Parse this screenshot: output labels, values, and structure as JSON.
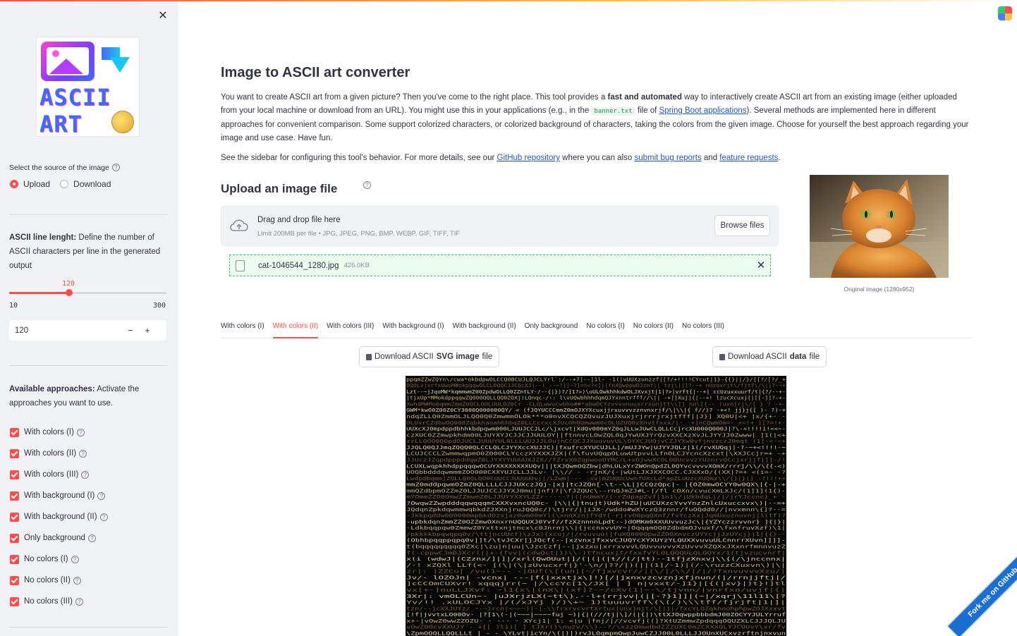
{
  "sidebar": {
    "close_icon": "close-icon",
    "logo_line1": "ASCII",
    "logo_line2": "ART",
    "source_label": "Select the source of the image",
    "source_options": [
      "Upload",
      "Download"
    ],
    "source_selected": "Upload",
    "line_length_title": "ASCII line lenght:",
    "line_length_desc": "Define the number of ASCII characters per line in the generated output",
    "slider_value": "120",
    "slider_min": "10",
    "slider_max": "300",
    "number_input_value": "120",
    "minus_label": "−",
    "plus_label": "+",
    "approaches_title": "Available approaches:",
    "approaches_desc": "Activate the approaches you want to use.",
    "approaches": [
      "With colors (I)",
      "With colors (II)",
      "With colors (III)",
      "With background (I)",
      "With background (II)",
      "Only background",
      "No colors (I)",
      "No colors (II)",
      "No colors (III)"
    ]
  },
  "main": {
    "title": "Image to ASCII art converter",
    "intro": {
      "p1": "You want to create ASCII art from a given picture? Then you've come to the right place. This tool provides a ",
      "p1_bold": "fast and automated",
      "p2": " way to interactively create ASCII art from an existing image (either uploaded from your local machine or download from an URL). You might use this in your applications (e.g., in the ",
      "code": "banner.txt",
      "p3": " file of ",
      "link": "Spring Boot applications",
      "p4": "). Several methods are implemented here in different approaches for convenient comparison. Some support colorized characters, or colorized background of characters, taking the colors from the given image. Choose for yourself the best approach regarding your image and use case. Have fun."
    },
    "note": {
      "t1": "See the sidebar for configuring this tool's behavior. For more details, see our ",
      "link1": "GitHub repository",
      "t2": " where you can also ",
      "link2": "submit bug reports",
      "t3": " and ",
      "link3": "feature requests",
      "t4": "."
    },
    "upload_heading": "Upload an image file",
    "dropzone_title": "Drag and drop file here",
    "dropzone_limit": "Limit 200MB per file • JPG, JPEG, PNG, BMP, WEBP, GIF, TIFF, TIF",
    "browse_label": "Browse files",
    "file_name": "cat-1046544_1280.jpg",
    "file_size": "426.0KB",
    "image_caption": "Original image (1280x952)",
    "tabs": [
      "With colors (I)",
      "With colors (II)",
      "With colors (III)",
      "With background (I)",
      "With background (II)",
      "Only background",
      "No colors (I)",
      "No colors (II)",
      "No colors (III)"
    ],
    "active_tab": "With colors (II)",
    "download_svg": {
      "pre": "Download ASCII",
      "bold": "SVG image",
      "post": "file"
    },
    "download_data": {
      "pre": "Download ASCII",
      "bold": "data",
      "post": "file"
    },
    "ascii_lines": [
      "ppqmZZwZQYn\\/cwa*okbdpwOLCCQ0BCUJLQJCLYrl`:/--+7]--]1l-  -1(|vUUXzunzzf|[?/+!!!!CYcut|1}-{{}||/}/[[?/[?/_+",
      "OQOLvjxrfxUwoM#okpqqwOLCL0QQCJJCQcXJ|--(_--~?][~?]==<?<]||fnXQwppwOJznf||  tzj\\||]?-~+   nUzuxrjt\\/fjtf\\/\\|]?-~+",
      "Lzt--~jJqoMW*kqmmwmZ00ZpdwOLLQ0ZZntLY-/--{|})?/]1?>)\\uULOwkhhkdwOLJXvxjt|1|?>|vrft{|--+|  ccUzuxxuurf/t|{?/--+-",
      "|tjxUp*MMokdppqqwZQ000QQLLQQ0ZOXj)LQnqc-/:: l\\vUQwbhhhdqmQJYxnntrfff//\\|| -+]]Xuj|{|--+!  lzucXcuxj{|[[-]]?-+-",
      "XwhdM#MobqmmZmmZ0QCLOOLUULOZ0Cr  -CLQLwwucwbho##*abwOCYzvvvunuuxrrxunjtt\\\\]]  nn\\[{--  (uxnjrj\\/{ } ?  -+-",
      "GWM*kwO0Z00Z0CY3000Q000000QY/ < (fJQYUCCCmmZ0mOJXYXcuxjjrxuvvvzznvnxrjf/\\|\\\\|{   f//)?   -+<!  jj}j{[ )- ?)-+",
      "ndqZLLQ0ZmmOLJLQQ0Q0ZmwmmOLOk***o0nvXCQCQZQvuzJUJXuxjrjrrrjrxjtfff||J}]  XQ0U|<+  |x/{+-  -",
      "OLUvrCZdbwOQ000ZqbkhaoahhhbqZ0LLCcrxcXJUcOh0Umwwm0cOLUZUQ0zXnvtfxxx/|-  -+]nCQwmOm=-   +<!+  ][?=!+-",
      "UUXcXJ0mpdppdbhhkbdpqwm000LJUUJCCJLc/\\jxcvt|XdQv000mYZ0qJLLwJUwCLQLLCcjrcXU000Q000J|?\\-<!!!!i!<<~-",
      "czXUC0ZZmwpkhdm00LJUYXYJCJJCJJUULOY||ftnnvcLOwZQL0qJYwUXJYrQzvXXCXzXvJLJYYJJ0Zwww|   ]1(|<+",
      "zzLLQOQ0QOpdOJUCLJUUUYUL0LLLUUJJJLOujnCCQCJJXuuvuvUL\\OYXCJUQjvCZJYXw0vfjnvzczJ0mqt   (1]-<-~+",
      "JJQLQ0QJJmqZQQQ0QLCCLQLCJYYXccXUJJC)|fxufrcXYUCUJLL|/mUJJYw|UJYYJQLz|1(/rvXUQqj|-?-~+<!!!!-~",
      "LCUJCCCLZwmmwqpmO0Z000CLYcczXYXXXJZX|(f\\fuvUQqpOLuwUtpvvLLfnOLCJYcncXzcxt|\\XXJCcjr=+  -+",
      "JJUczJZqpdpppddqwZ0LJYXYYUUUUXJZX//fZrvX0ZqpwooOYMC/L+xOjwwXCOL0QUcvvzYUznrvQCcjxrjjf|]]-/!",
      "LCUXLwqpkhhdppqqqwOCUYXXXXXXXXUQv|||tXJQwmOQZbw|dhLULxYrZWOnQpdZL0QYvcvvvvXOmX/rrrj/\\\\/\\{{-<)",
      "UOQbbdddqwmmmZOO000CXXYUJCLLJJLv-  |\\\\// -  -rjnX/{-|wUtLJXJXXCOCC.CJXXxO/{(XX|?=+    <(i=-  -?",
      "Lwdpdbqmm]ZQLLQ0QLQO0CUUCCJUUUU0v||/LZwm|--- -xv|mZUQUcUwnfUXcLd*apZLUUzcXUQmz\\\\/{}|}|]  -?!!!++",
      "mmZ0mddpqwmOZmZ0QLLLLCJJJUXczJQj-|xj|tcJZQn[-\\t--\\L|jCCQzQpc|-    |{OZ0mwOCYY0w0QX\\|{-|-+",
      "mmQZdbpmOZZmZ0LJJUJCCJJYXJ0mu|jnf)?|\\fJZQUc\\--rnQJmZJ#L-|/fl cOXn/cvucXmLXJc/(1]1](1{)-",
      "mYOmmZZO0OmwZZmwmZ0LJJUYYXXYLZZr-----?|(|nUmmY/(-rZdpapZvf|1n1\\/jUkbdqL|/|/jrYJccnc}_+  -",
      "?OwqwZZwpdddqqwqqqmCXXXvxncUQ0c-  |\\\\|{|tnujt)Udk*hZU|uUCUXzcYvvYnzZnlcUxuccxvx\\)|--=+",
      "JQdqnZpkdqwmmwqbkdZJXXnjruJQQ0c/)\\tjrr/||iJX-/wddo#wXYczQ3znnr/fuOQdd0//|nvxmnn\\{]?--=",
      "-Jkkpqddw000000mpbkdOzxjaz0wm00mY)(\\xnnXznjfYdY[-rjrvO0pqQXnf/fvYczXx|JqmUxuznuvnjjl(tf)?",
      "-upbkdqnZmmZZ0OZZmwOXnxrnUQQUXJ0Yvf//fzXznnnnLpdt--)dOMKm0XXUUvvuzJc\\|{YZYczzrvvnr} ]{|}|",
      "-Ldkbqqpqw0ZmmwZ0Yxttxnjtncx\\c0Jnrnj\\\\|{jccnxvvUY~|OqqqmOQ0ZdbdmOJvuxf/\\fxnfruvXzf)\\1|",
      "/pkkkkbpqwqpq0v/\\ttjncUUcf)\\zJx){xcuj/|/rvuvuu(|fuXQ000QpwZZOQXnvczUYYcjjJzUYcj}|1|{{}--",
      "(Obhbpqqppqpq0v|]t/\\tvJCXr|jJQcf(--|xzvnxjfxxvCJUQYcXYXUYzYLQUXXvuvuULCnnrrXUvn]]]]-",
      "t(bqqqqqqqqq0ZXc|\\zu|n|uu|\\JzcCzf|--|jxzxu|xrrxvvvLQUvvuvvvXzUvvvXZQXxJXxnrfmnnvuzZ",
      "f(-cppwCJmDJXcr(||+-{fvv|(cdwQct|1)\\\\-)tfncuxjf/fxxfvYL0LQQQULQLQQYx/1(tjvzucvnrf|",
      "x(i  (wdwJ|(CZznx/]|]|/xrl(QwOUut|]/(|(|(|t//(/|tt)--1tfjzXnxvj\\\\{(/\\jnccnnx|",
      "/-! xZQXl  LLf(<-   [(\\|(\\|zUvucxrf|}'-\\n/|??/|)(||(1]/-1)|(/-\\ruzzCXuxvn\\)|\\|",
      "zr|: |ZZCu|  /vu(1~--   -|QUf(\\[(un|[~/fjxvcvr//|(\\/|/\\\\/|/|/?fxnvuvvvXzu/|",
      "Jv/- lOZOJn|  -vcnx|   ---|f(|xxxtjx\\]!)[/|jxnxvzcvznjxfjnun/(|/rrnjjftj|/",
      "]cCCOmCUXvr!  xqqqjrr(~  |/\\ccYc[1\\/JX[ |  ]  n|vxxt/-]1}|[{(|xv}|)t}!]tl",
      "vx[+-]nuLLJXvf:  ~l1{x\\|(nX\\|(xf]?-~/cXv(1|~-\\/tjvnn/|vnrfxn/uvjf|{|",
      "3Xr|: vmOLCUn~-  |uJXrjzLX(~tt\\).--l+(rrjvv|(|[-?}1]]|(~|/xqrj\\11l11\\[?",
      "Yv/!!  .xULOCJYx  |/(/xJYj )/)\\+~  1)tuuuvrff\\(\\(/)\\\\\\tff/fjrjft|1|]|",
      "tzn/--jcXXJUYz/  ~-~)rcn|<~~~)|-|-\\\\frxrvcvrtXrfux|unxjnjt/\\[|1|/fxcYLOZqkhoohphpwZOJXxxvt",
      "[!f|jvvtxLO00Ov-  |?[1\\(-|(~~~|~~~~fuj  ~)|{|(///tj|\\]/(|{|)\\ttXJOqwppbbbdmJ00ZOCYYJULYrruf",
      "x+-|vOwZ0wwZZOZU-  -  ---  -  XYcj1| 1:  <|u   |fnj/|//vcvfj((]?XtUZmmwZpdqqqOQUZXLCJJJQLJU",
      "   vOwZ0OcvXXUJY  - +[[  )l1)[ ] tJXr()\\nuzv/\\\\)--?/\\xzzOmwdbdZZZUXC0mZCXXXQLYJCUUvY\\xr/fv",
      "\\ZpmOQQLLQQLLLt   |  - -  \\YLvt|icYn/\\(|)|)rvJLOqmpmQwpJuwCZJJ00L0LLLJJOUnXUCxvzrftnjnxvun"
    ],
    "colors": {
      "accent": "#ff4b4b",
      "link": "#1f55c8",
      "upload_ok": "#2ecc71",
      "ascii_bg": "#070707",
      "ascii_fg1": "#c9b07a",
      "ascii_fg2": "#7d5f38",
      "ascii_fg3": "#e6d3a3"
    },
    "ribbon_label": "Fork me on GitHub",
    "app_icon": "streamlit-app-icon"
  }
}
